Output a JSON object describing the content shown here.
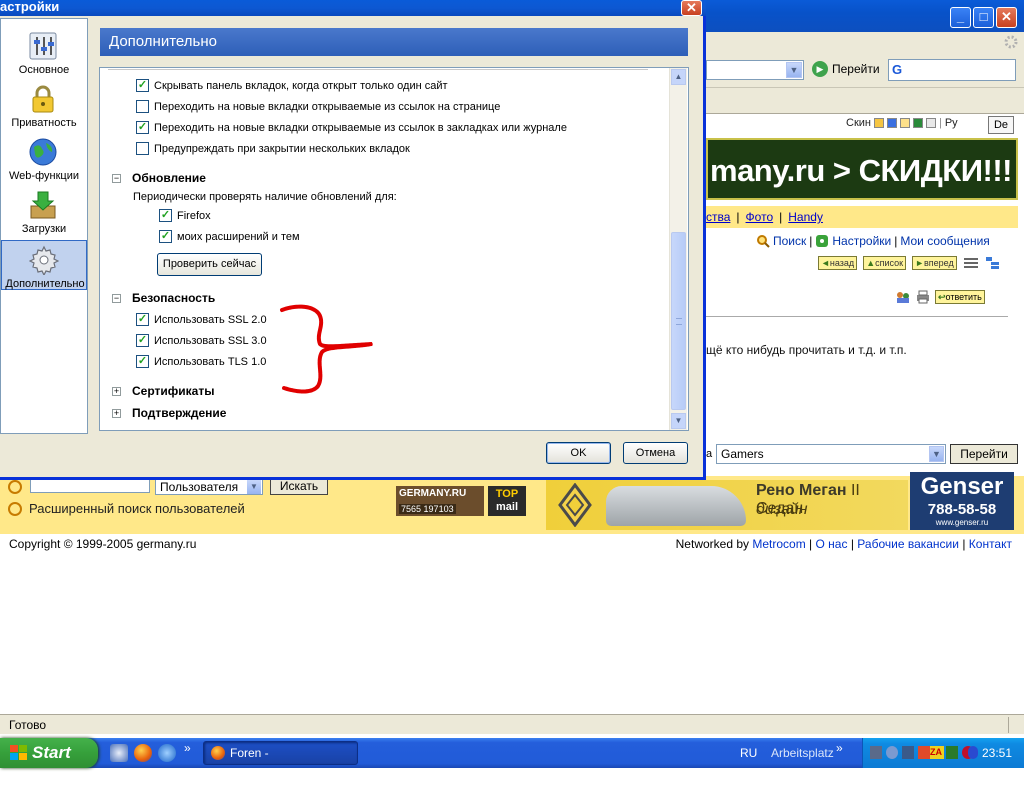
{
  "dialog": {
    "title": "астройки",
    "close_glyph": "✕",
    "categories": [
      {
        "label": "Основное",
        "icon": "settings-sliders-icon"
      },
      {
        "label": "Приватность",
        "icon": "padlock-icon"
      },
      {
        "label": "Web-функции",
        "icon": "globe-icon"
      },
      {
        "label": "Загрузки",
        "icon": "download-box-icon"
      },
      {
        "label": "Дополнительно",
        "icon": "gear-icon",
        "selected": true
      }
    ],
    "pane_title": "Дополнительно",
    "tabs_options": [
      {
        "label": "Скрывать панель вкладок, когда открыт только один сайт",
        "checked": true
      },
      {
        "label": "Переходить на новые вкладки открываемые из ссылок на странице",
        "checked": false
      },
      {
        "label": "Переходить на новые вкладки открываемые из ссылок в закладках или журнале",
        "checked": true
      },
      {
        "label": "Предупреждать при закрытии нескольких вкладок",
        "checked": false
      }
    ],
    "update_section": {
      "title": "Обновление",
      "toggle": "−",
      "description": "Периодически проверять наличие обновлений для:",
      "options": [
        {
          "label": "Firefox",
          "checked": true
        },
        {
          "label": "моих расширений и тем",
          "checked": true
        }
      ],
      "check_now": "Проверить сейчас"
    },
    "security_section": {
      "title": "Безопасность",
      "toggle": "−",
      "options": [
        {
          "label": "Использовать SSL 2.0",
          "checked": true
        },
        {
          "label": "Использовать SSL 3.0",
          "checked": true
        },
        {
          "label": "Использовать TLS 1.0",
          "checked": true
        }
      ]
    },
    "certificates_section": {
      "title": "Сертификаты",
      "toggle": "+"
    },
    "validation_section": {
      "title": "Подтверждение",
      "toggle": "+"
    },
    "ok_label": "OK",
    "cancel_label": "Отмена",
    "check_glyph": "✓"
  },
  "browser": {
    "go_label": "Перейти",
    "search_engine_glyph": "G",
    "skin_label": "Скин",
    "lang_ru": "Ру",
    "lang_de": "De",
    "banner_text": "many.ru > СКИДКИ!!!",
    "menu_links": [
      "ства",
      "Фото",
      "Handy"
    ],
    "toolbar": {
      "search": "Поиск",
      "settings": "Настройки",
      "messages": "Мои сообщения",
      "sep": "|"
    },
    "nav_buttons": [
      "назад",
      "список",
      "вперед"
    ],
    "answer_label": "ответить",
    "post_text": "щё кто нибудь прочитать и т.д. и т.п.",
    "forum_select_prefix": "а",
    "forum_select_value": "Gamers",
    "forum_go": "Перейти",
    "user_select_value": "Пользователя",
    "user_search_btn": "Искать",
    "ext_search": "Расширенный поиск пользователей",
    "germany_badge": "GERMANY.RU",
    "germany_counter": "7565",
    "germany_counter2": "197103",
    "topmail_top": "TOP",
    "topmail_bottom": "mail",
    "renault_line1_a": "Рено Меган",
    "renault_line1_b": " II Седан",
    "renault_line2": "дизайн",
    "genser_name": "Genser",
    "genser_phone": "788-58-58",
    "genser_site": "www.genser.ru",
    "copyright": "Copyright © 1999-2005 germany.ru",
    "footer": {
      "networked_by": "Networked by",
      "metrocom": "Metrocom",
      "about": "О нас",
      "jobs": "Рабочие вакансии",
      "contact": "Контакт",
      "sep": "|"
    },
    "status": "Готово"
  },
  "taskbar": {
    "start": "Start",
    "task_label": "Foren - GERMANY.RU...",
    "more": "»",
    "lang": "RU",
    "toolbar_name": "Arbeitsplatz",
    "clock": "23:51"
  },
  "colors": {
    "xp_blue": "#0a5bd8",
    "pane_header": "#3a6bc4",
    "banner_bg": "#1c3a12",
    "forum_yellow": "#ffe889",
    "scribble_red": "#e00000"
  }
}
